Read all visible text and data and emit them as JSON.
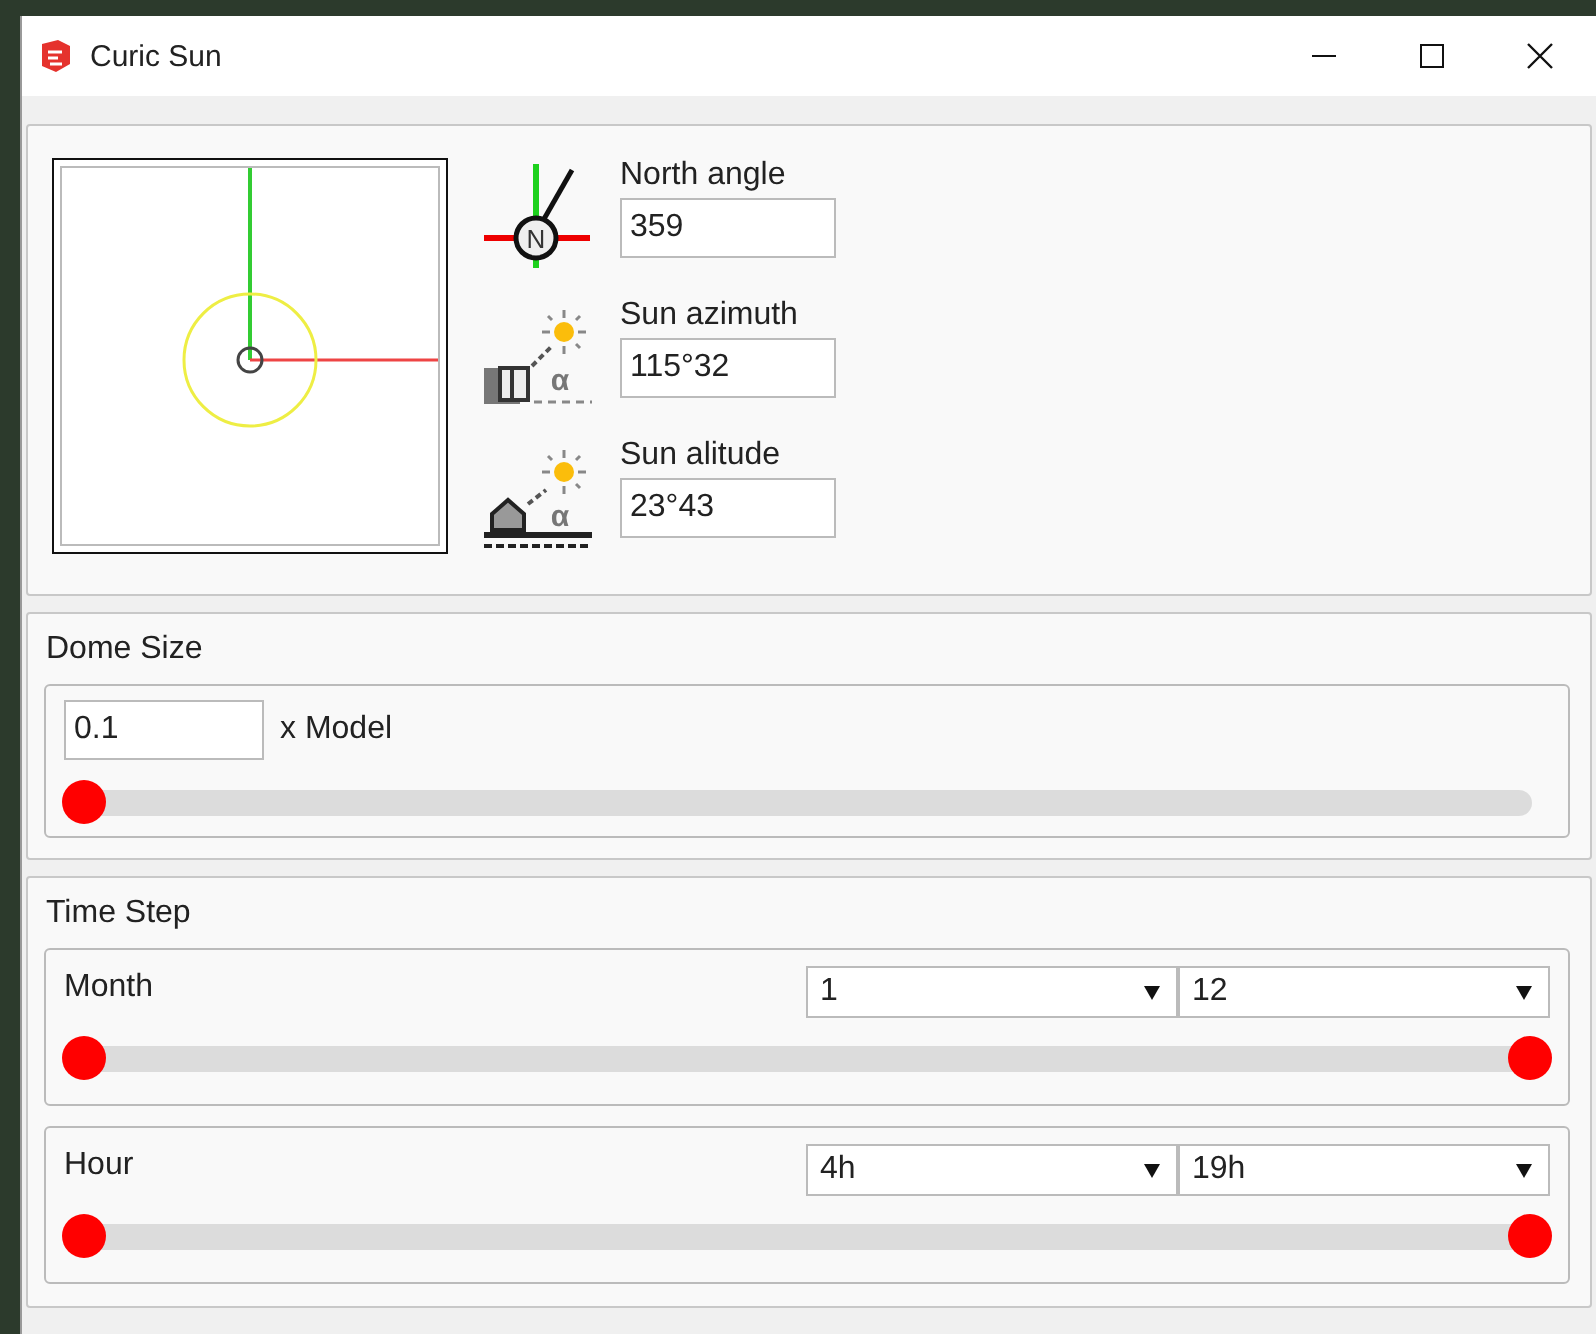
{
  "window": {
    "title": "Curic Sun"
  },
  "orientation": {
    "fields": [
      {
        "kind": "north",
        "label": "North angle",
        "value": "359",
        "icon_letter": "N"
      },
      {
        "kind": "azimuth",
        "label": "Sun azimuth",
        "value": "115°32",
        "icon_letter": "α"
      },
      {
        "kind": "altitude",
        "label": "Sun alitude",
        "value": "23°43",
        "icon_letter": "α"
      }
    ]
  },
  "dome_size": {
    "title": "Dome Size",
    "value": "0.1",
    "unit": "x Model",
    "level": 0
  },
  "time_step": {
    "title": "Time Step",
    "ranges": [
      {
        "label": "Month",
        "from": "1",
        "to": "12",
        "thumbs": [
          {
            "level": 0
          },
          {
            "level": 1
          }
        ]
      },
      {
        "label": "Hour",
        "from": "4h",
        "to": "19h",
        "thumbs": [
          {
            "level": 0
          },
          {
            "level": 1
          }
        ]
      }
    ]
  }
}
